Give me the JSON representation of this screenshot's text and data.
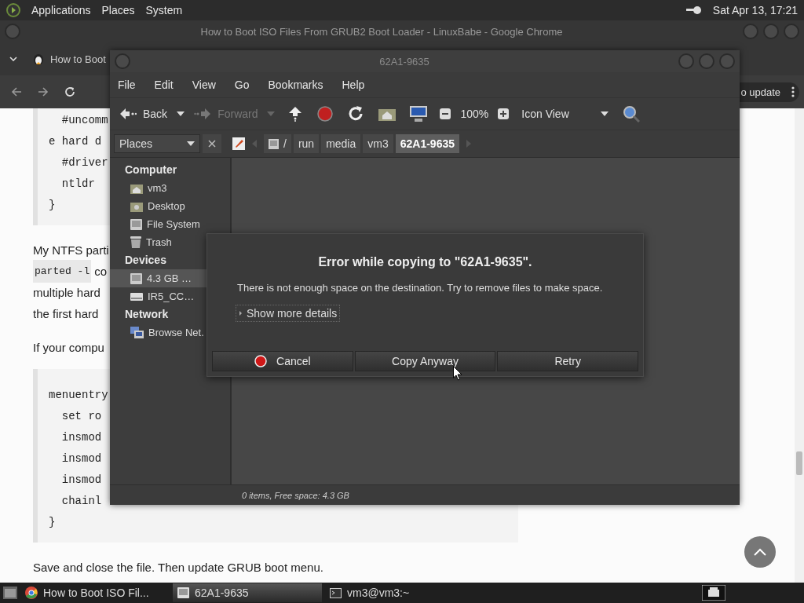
{
  "top_panel": {
    "menus": [
      "Applications",
      "Places",
      "System"
    ],
    "clock": "Sat Apr 13, 17:21"
  },
  "browser": {
    "title": "How to Boot ISO Files From GRUB2 Boot Loader - LinuxBabe - Google Chrome",
    "tab": "How to Boot",
    "update_button": "o update",
    "page": [
      {
        "kind": "code",
        "lines": [
          "  #uncomm",
          "e hard d",
          "  #driver",
          "  ntldr",
          "}"
        ]
      },
      {
        "kind": "para",
        "lines": [
          {
            "text": "My NTFS parti"
          },
          {
            "code": "parted -l",
            "text": "co"
          },
          {
            "text": "multiple hard"
          },
          {
            "text": "the first hard"
          }
        ]
      },
      {
        "kind": "para",
        "lines": [
          {
            "text": "If your compu"
          }
        ]
      },
      {
        "kind": "code",
        "lines": [
          "menuentry",
          "  set ro",
          "  insmod",
          "  insmod",
          "  insmod",
          "  chainl",
          "}"
        ]
      },
      {
        "kind": "para",
        "lines": [
          {
            "text": "Save and close the file. Then update GRUB boot menu."
          }
        ]
      }
    ]
  },
  "file_manager": {
    "title": "62A1-9635",
    "menu": [
      "File",
      "Edit",
      "View",
      "Go",
      "Bookmarks",
      "Help"
    ],
    "toolbar": {
      "back": {
        "label": "Back",
        "disabled": false
      },
      "forward": {
        "label": "Forward",
        "disabled": true
      },
      "zoom": "100%",
      "view": "Icon View"
    },
    "sidebar": {
      "selector": "Places",
      "groups": [
        {
          "heading": "Computer",
          "items": [
            {
              "label": "vm3",
              "kind": "home",
              "selected": false
            },
            {
              "label": "Desktop",
              "kind": "desktop",
              "selected": false
            },
            {
              "label": "File System",
              "kind": "drive",
              "selected": false
            },
            {
              "label": "Trash",
              "kind": "trash",
              "selected": false
            }
          ]
        },
        {
          "heading": "Devices",
          "items": [
            {
              "label": "4.3 GB …",
              "kind": "drive",
              "selected": true
            },
            {
              "label": "IR5_CC…",
              "kind": "disc",
              "selected": false
            }
          ]
        },
        {
          "heading": "Network",
          "items": [
            {
              "label": "Browse Net.",
              "kind": "network",
              "selected": false
            }
          ]
        }
      ]
    },
    "path": {
      "root": "/",
      "segments": [
        {
          "label": "run",
          "selected": false
        },
        {
          "label": "media",
          "selected": false
        },
        {
          "label": "vm3",
          "selected": false
        },
        {
          "label": "62A1-9635",
          "selected": true
        }
      ]
    },
    "status": "0 items, Free space: 4.3 GB"
  },
  "dialog": {
    "title": "Error while copying to \"62A1-9635\".",
    "message": "There is not enough space on the destination. Try to remove files to make space.",
    "expander": {
      "label": "Show more details",
      "expanded": false
    },
    "buttons": [
      {
        "label": "Cancel",
        "kind": "cancel"
      },
      {
        "label": "Copy Anyway",
        "kind": "plain"
      },
      {
        "label": "Retry",
        "kind": "plain"
      }
    ]
  },
  "taskbar": {
    "tasks": [
      {
        "label": "How to Boot ISO Fil...",
        "kind": "browser",
        "selected": false
      },
      {
        "label": "62A1-9635",
        "kind": "folder",
        "selected": true
      },
      {
        "label": "vm3@vm3:~",
        "kind": "terminal",
        "selected": false
      }
    ]
  }
}
